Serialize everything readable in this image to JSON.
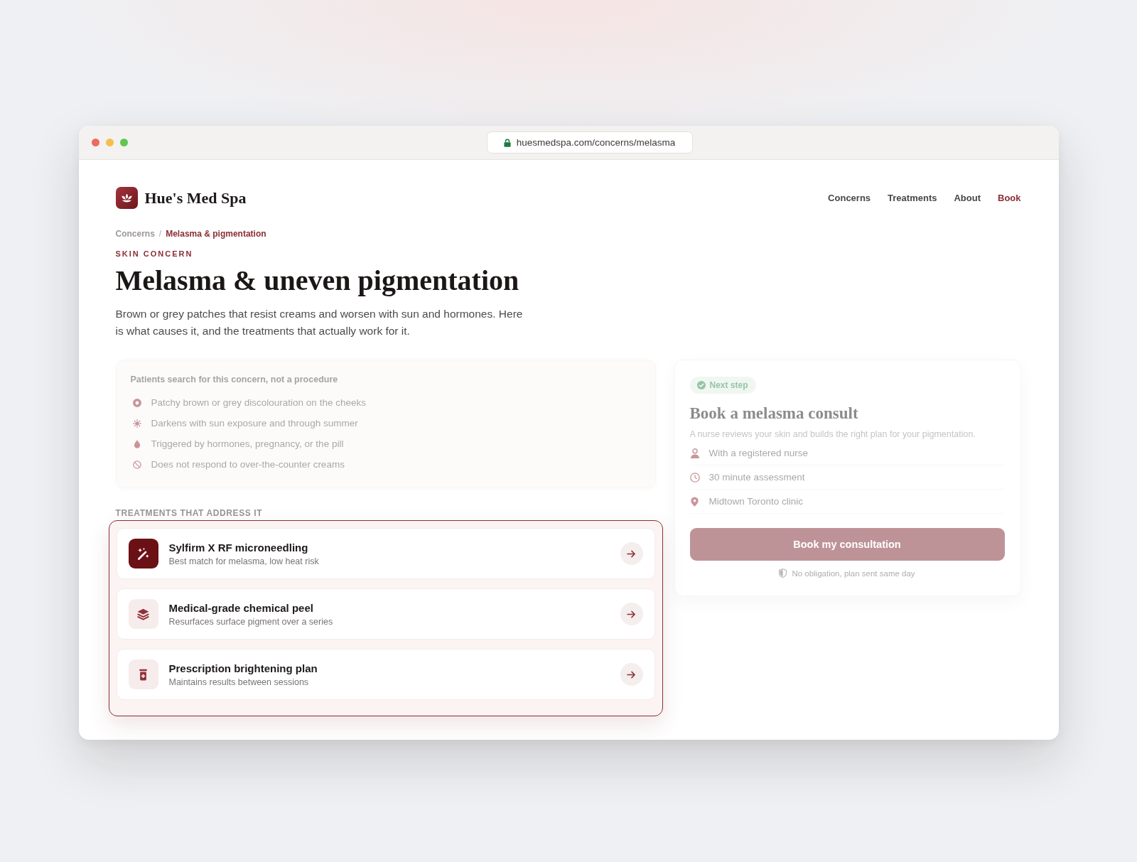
{
  "browser": {
    "url": "huesmedspa.com/concerns/melasma"
  },
  "header": {
    "brand": "Hue's Med Spa",
    "nav": [
      {
        "label": "Concerns",
        "kind": "link"
      },
      {
        "label": "Treatments",
        "kind": "link"
      },
      {
        "label": "About",
        "kind": "link"
      },
      {
        "label": "Book",
        "kind": "accent"
      }
    ]
  },
  "breadcrumb": {
    "separator": "/",
    "items": [
      {
        "label": "Concerns",
        "current": false
      },
      {
        "label": "Melasma & pigmentation",
        "current": true
      }
    ]
  },
  "eyebrow": "SKIN CONCERN",
  "title": "Melasma & uneven pigmentation",
  "intro": "Brown or grey patches that resist creams and worsen with sun and hormones. Here is what causes it, and the treatments that actually work for it.",
  "search_box": {
    "dimmed": true,
    "title": "Patients search for this concern, not a procedure",
    "items": [
      "Patchy brown or grey discolouration on the cheeks",
      "Darkens with sun exposure and through summer",
      "Triggered by hormones, pregnancy, or the pill",
      "Does not respond to over-the-counter creams"
    ]
  },
  "treatments": {
    "heading": "TREATMENTS THAT ADDRESS IT",
    "highlighted": true,
    "items": [
      {
        "title": "Sylfirm X RF microneedling",
        "subtitle": "Best match for melasma, low heat risk",
        "highlighted": true
      },
      {
        "title": "Medical-grade chemical peel",
        "subtitle": "Resurfaces surface pigment over a series",
        "highlighted": false
      },
      {
        "title": "Prescription brightening plan",
        "subtitle": "Maintains results between sessions",
        "highlighted": false
      }
    ]
  },
  "booking_card": {
    "dimmed": true,
    "badge": "Next step",
    "title": "Book a melasma consult",
    "text": "A nurse reviews your skin and builds the right plan for your pigmentation.",
    "details": [
      "With a registered nurse",
      "30 minute assessment",
      "Midtown Toronto clinic"
    ],
    "button": "Book my consultation",
    "note": "No obligation, plan sent same day"
  }
}
